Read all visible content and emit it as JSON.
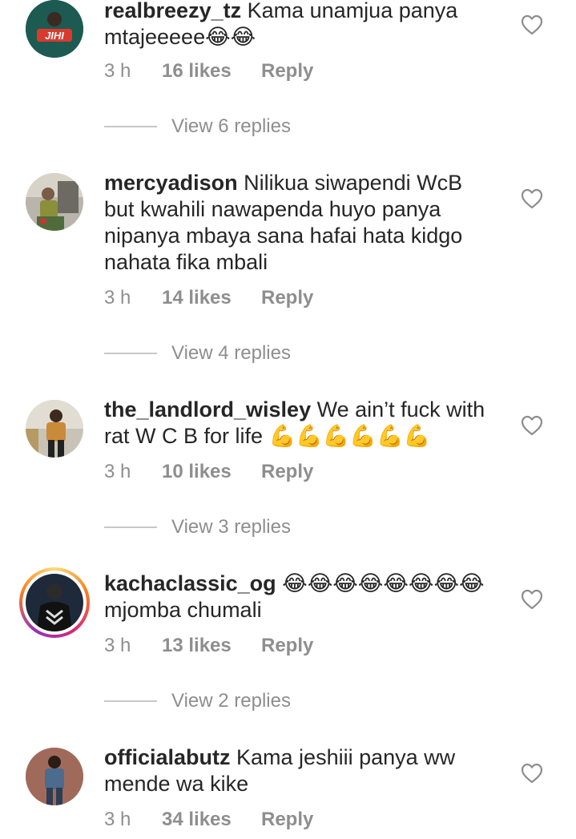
{
  "comments": [
    {
      "username": "realbreezy_tz",
      "text": " Kama unamjua panya\nmtajeeeee😂😂",
      "time": "3 h",
      "likes": "16 likes",
      "reply": "Reply",
      "view_replies": "View 6 replies",
      "avatar_label": "JIHI"
    },
    {
      "username": "mercyadison",
      "text": " Nilikua siwapendi WcB\nbut kwahili nawapenda huyo panya\nnipanya mbaya sana hafai hata kidgo\nnahata fika mbali",
      "time": "3 h",
      "likes": "14 likes",
      "reply": "Reply",
      "view_replies": "View 4 replies"
    },
    {
      "username": "the_landlord_wisley",
      "text": " We ain’t fuck with\nrat W C B for life 💪💪💪💪💪💪",
      "time": "3 h",
      "likes": "10 likes",
      "reply": "Reply",
      "view_replies": "View 3 replies"
    },
    {
      "username": "kachaclassic_og",
      "text": " 😂😂😂😂😂😂😂😂\nmjomba chumali",
      "time": "3 h",
      "likes": "13 likes",
      "reply": "Reply",
      "view_replies": "View 2 replies"
    },
    {
      "username": "officialabutz",
      "text": " Kama jeshiii panya ww\nmende wa kike",
      "time": "3 h",
      "likes": "34 likes",
      "reply": "Reply"
    }
  ],
  "icons": {
    "like": "heart-outline-icon"
  },
  "colors": {
    "meta": "#8e8e8e",
    "text": "#262626",
    "divider": "#c7c7c7"
  }
}
